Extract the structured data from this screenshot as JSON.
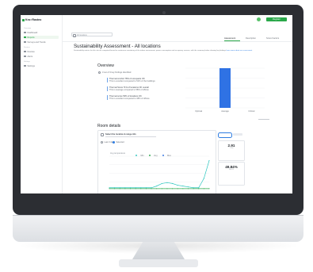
{
  "app": {
    "brand": "Kro◐Rasteo",
    "register_label": "Register",
    "search_placeholder": "All locations"
  },
  "sidebar": {
    "sections": [
      "Overview",
      "Devices",
      "Settings"
    ],
    "items": [
      {
        "label": "Dashboard"
      },
      {
        "label": "Reports"
      },
      {
        "label": "Surveys and Trends"
      },
      {
        "label": "Devices"
      },
      {
        "label": "Alerts"
      },
      {
        "label": "Settings"
      }
    ]
  },
  "tabs": [
    "Assessment",
    "Description",
    "Score Factors"
  ],
  "page": {
    "title": "Sustainability Assessment - All locations",
    "description": "Sustainability metrics for this site are computed based on continuous monitoring of the indoor environment, power consumption and occupancy sensors, with the summary below showing key findings",
    "link": "learn more about our assessment"
  },
  "overview": {
    "title": "Overview",
    "lead": "3 out of 3 key findings identified",
    "insights": [
      {
        "head": "Thermal comfort 78% of occupants OK",
        "body": "This is excellent compared to 52% of the buildings"
      },
      {
        "head": "Thermal Score 71% of locations OK overall",
        "body": "This is average compared to 58% of offices"
      },
      {
        "head": "Thermal score 50% of locations OK",
        "body": "This is excellent compared to 38% of offices"
      }
    ]
  },
  "chart_data": [
    {
      "type": "bar",
      "categories": [
        "Optimal",
        "Average",
        "Critical"
      ],
      "values": [
        0,
        100,
        0
      ],
      "ylim": [
        0,
        100
      ],
      "color": "#2f72e4",
      "grid": true
    },
    {
      "type": "line",
      "x": [
        1,
        2,
        3,
        4,
        5,
        6,
        7,
        8,
        9,
        10,
        11,
        12,
        13,
        14,
        15,
        16,
        17,
        18,
        19,
        20
      ],
      "series": [
        {
          "values": [
            2,
            2,
            2,
            2,
            2,
            2,
            2,
            2,
            2,
            2,
            2,
            2,
            2,
            2,
            2,
            2,
            2,
            2,
            2,
            2
          ],
          "color": "#2aa84a"
        },
        {
          "values": [
            3,
            3,
            3,
            3,
            3,
            3,
            3,
            3,
            3,
            5,
            8,
            9,
            8,
            6,
            5,
            4,
            3,
            3,
            14,
            35
          ],
          "color": "#2ec7c0"
        }
      ],
      "ylim": [
        0,
        40
      ],
      "grid": true
    }
  ],
  "room": {
    "title": "Room details",
    "panel_title": "Select the location & range info",
    "toggle_options": [
      "Last 3 days",
      "Selected"
    ],
    "legend": [
      "Min",
      "Avg",
      "Max"
    ],
    "series_label": "Avg temperature"
  },
  "cards": [
    {
      "value": "2.91",
      "sub": "°C/m"
    },
    {
      "value": "49.84%",
      "sub": "RH %"
    }
  ],
  "legend_colors": {
    "teal": "#2ec7c0",
    "green": "#2aa84a",
    "blue": "#2f72e4"
  }
}
